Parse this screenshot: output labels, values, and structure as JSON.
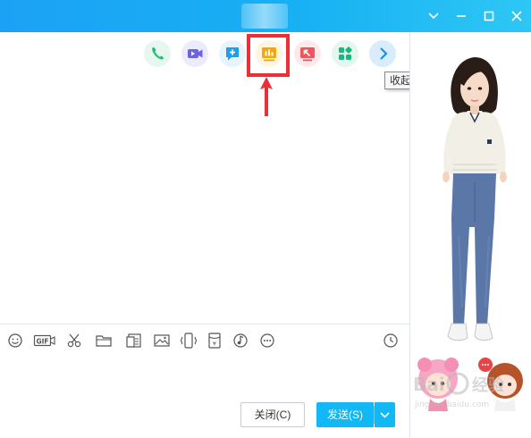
{
  "window": {
    "controls": [
      "chevron-down-icon",
      "minimize-icon",
      "maximize-icon",
      "close-icon"
    ],
    "title_bar_colors": [
      "#1ca2f4",
      "#2ec7f4"
    ]
  },
  "toolbar": {
    "icons": [
      "phone-icon",
      "video-icon",
      "chat-add-icon",
      "screen-share-icon",
      "remote-assist-icon",
      "apps-icon",
      "chevron-right-icon"
    ],
    "highlighted": "screen-share-icon",
    "highlight_color": "#ec2f36",
    "tooltip": "收起"
  },
  "input_tools": [
    "emoji-icon",
    "gif-icon",
    "scissors-icon",
    "folder-icon",
    "image-gallery-icon",
    "picture-icon",
    "shake-icon",
    "red-packet-icon",
    "music-icon",
    "more-icon"
  ],
  "history_icon": "clock-icon",
  "buttons": {
    "close_label": "关闭(C)",
    "send_label": "发送(S)",
    "send_color": "#12b7f5"
  },
  "right_panel": {
    "figure": "qq-show-avatar",
    "watermark": "Baidu 经验",
    "watermark_url": "jingyan.baidu.com"
  }
}
